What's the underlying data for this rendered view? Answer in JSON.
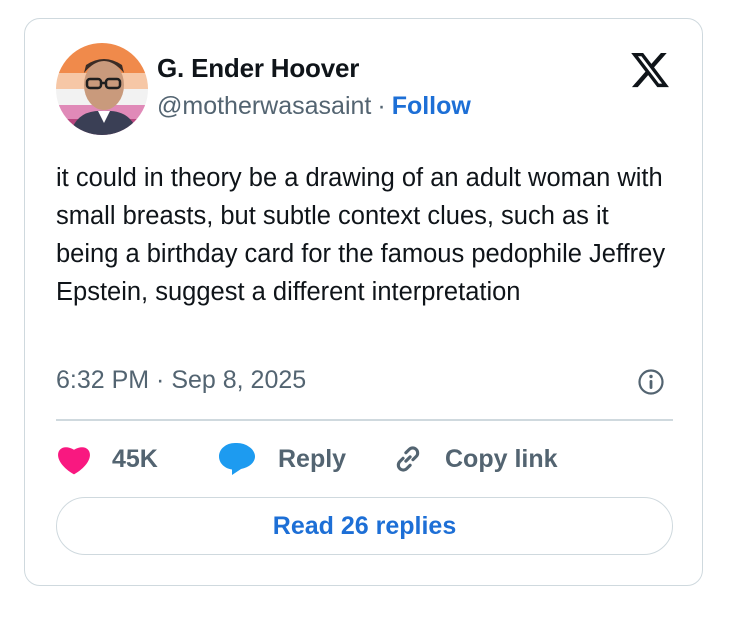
{
  "author": {
    "name": "G. Ender Hoover",
    "handle": "@motherwasasaint",
    "separator": "·",
    "follow_label": "Follow"
  },
  "tweet": {
    "text": "it could in theory be a drawing of an adult woman with small breasts, but subtle context clues, such as it being a birthday card for the famous pedophile Jeffrey Epstein, suggest a different interpretation",
    "timestamp": "6:32 PM · Sep 8, 2025"
  },
  "actions": {
    "likes": "45K",
    "reply_label": "Reply",
    "copy_link_label": "Copy link"
  },
  "read_replies_label": "Read 26 replies",
  "icons": {
    "logo": "x-logo-icon",
    "info": "info-icon",
    "like": "heart-icon",
    "reply": "speech-bubble-icon",
    "copy": "link-icon"
  },
  "colors": {
    "accent": "#1d6fd6",
    "like": "#f91880",
    "reply": "#1d9bf0",
    "muted": "#536471",
    "border": "#cfd9de"
  }
}
